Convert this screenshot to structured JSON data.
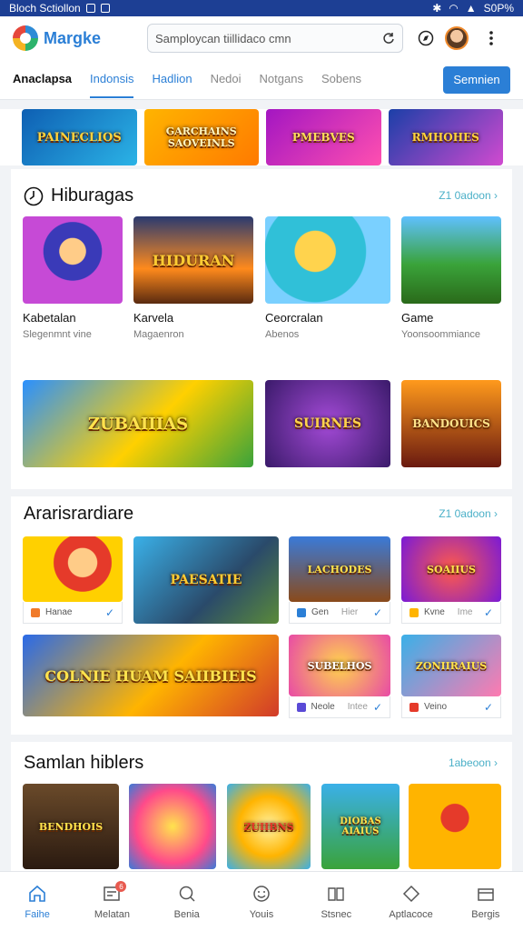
{
  "status_bar": {
    "left_text": "Bloch Sctiollon",
    "right_text": "S0P%"
  },
  "header": {
    "brand": "Margke",
    "search_placeholder": "Samploycan tiillidaco cmn"
  },
  "tabs": [
    "Anaclapsa",
    "Indonsis",
    "Hadlion",
    "Nedoi",
    "Notgans",
    "Sobens"
  ],
  "tabs_button": "Semnien",
  "banner": [
    "PAINECLIOS",
    "GARCHAINS SAOVEINLS",
    "PMEBVES",
    "RMHOHES"
  ],
  "section1": {
    "title": "Hiburagas",
    "more": "Z1 0adoon",
    "row1": [
      {
        "title": "Kabetalan",
        "sub": "Slegenmnt vine"
      },
      {
        "title": "Karvela",
        "sub": "Magaenron",
        "art": "HIDURAN"
      },
      {
        "title": "Ceorcralan",
        "sub": "Abenos"
      },
      {
        "title": "Game",
        "sub": "Yoonsoommiance"
      }
    ],
    "row2_art": [
      "ZUBAIIIAS",
      "SUIRNES",
      "BANDOUICS"
    ]
  },
  "section2": {
    "title": "Ararisrardiare",
    "more": "Z1 0adoon",
    "row1_art": [
      "",
      "PAESATIE",
      "LACHODES",
      "SOAIIUS"
    ],
    "row1_foot": [
      "Hanae",
      "",
      "Gen",
      "Kvne"
    ],
    "row1_foot_extra": [
      "",
      "",
      "Hier",
      "Ime"
    ],
    "row2_art": [
      "COLNIE HUAM SAIIBIEIS",
      "SUBELHOS",
      "ZONIIRAIUS"
    ],
    "row2_foot": [
      "Neole",
      "Veino"
    ],
    "row2_foot_extra": [
      "Intee",
      ""
    ]
  },
  "section3": {
    "title": "Samlan hiblers",
    "more": "1abeoon",
    "art": [
      "BENDHOIS",
      "",
      "ZUIIBNS",
      "DIOBAS AIAIUS",
      ""
    ]
  },
  "bottom_nav": [
    {
      "label": "Faihe",
      "icon": "home-icon"
    },
    {
      "label": "Melatan",
      "icon": "inbox-icon",
      "badge": "6"
    },
    {
      "label": "Benia",
      "icon": "search-icon"
    },
    {
      "label": "Youis",
      "icon": "smile-icon"
    },
    {
      "label": "Stsnec",
      "icon": "book-icon"
    },
    {
      "label": "Aptlacoce",
      "icon": "diamond-icon"
    },
    {
      "label": "Bergis",
      "icon": "wallet-icon"
    }
  ],
  "colors": {
    "accent": "#2b7fd6",
    "status_bar": "#1d3f94",
    "more_link": "#4bb0c8"
  }
}
